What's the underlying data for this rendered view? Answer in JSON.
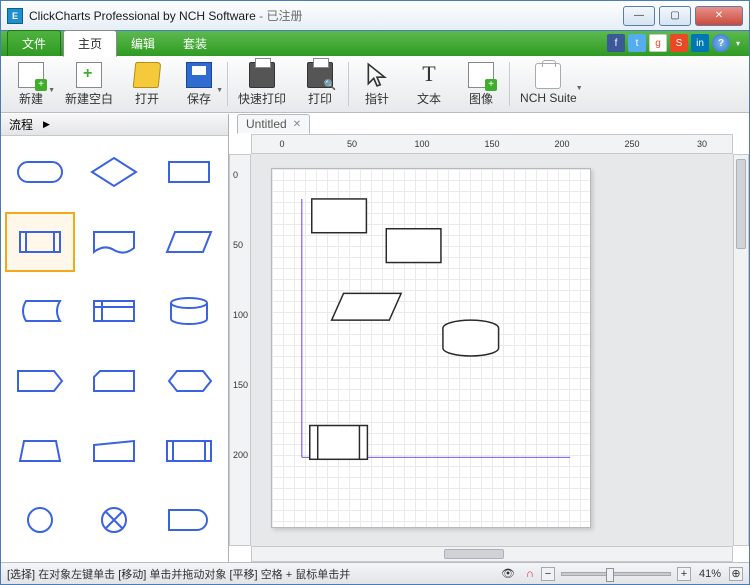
{
  "window": {
    "app_title": "ClickCharts Professional by NCH Software",
    "registered": "已注册"
  },
  "menu": {
    "file": "文件",
    "home": "主页",
    "edit": "编辑",
    "suite": "套装"
  },
  "toolbar": {
    "new": "新建",
    "new_blank": "新建空白",
    "open": "打开",
    "save": "保存",
    "quick_print": "快速打印",
    "print": "打印",
    "pointer": "指针",
    "text": "文本",
    "image": "图像",
    "nch_suite": "NCH Suite",
    "text_glyph": "T"
  },
  "sidebar": {
    "category": "流程"
  },
  "document": {
    "tab_title": "Untitled"
  },
  "ruler": {
    "h_ticks": [
      0,
      50,
      100,
      150,
      200,
      250,
      30
    ],
    "v_ticks": [
      0,
      50,
      100,
      150,
      200
    ]
  },
  "status": {
    "select_label": "[选择]",
    "select_hint": "在对象左键单击",
    "move_label": "[移动]",
    "move_hint": "单击并拖动对象",
    "pan_label": "[平移]",
    "pan_hint": "空格 + 鼠标单击并",
    "zoom_value": "41%"
  }
}
